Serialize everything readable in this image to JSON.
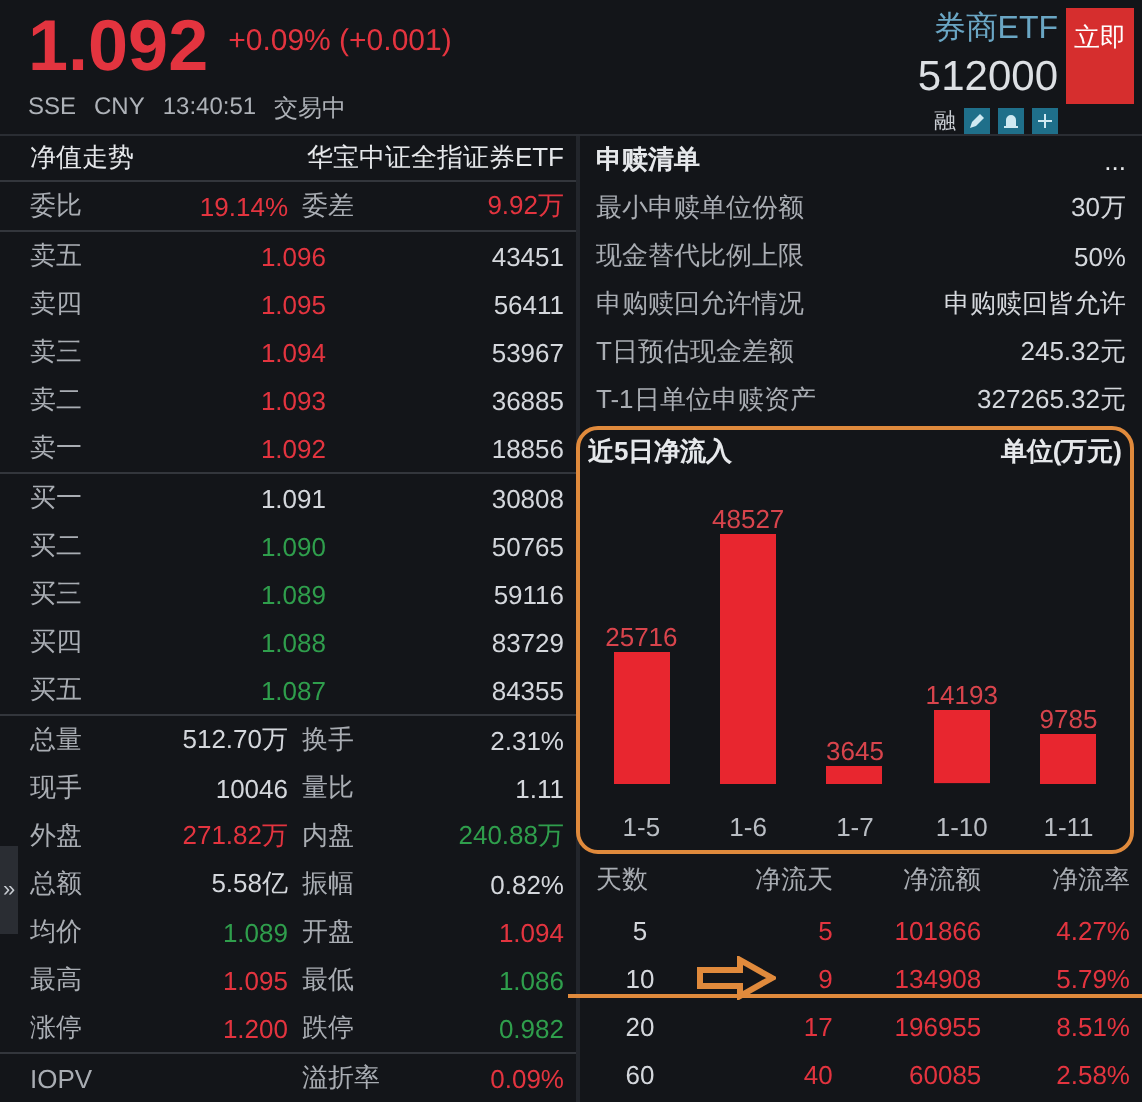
{
  "header": {
    "price": "1.092",
    "change": "+0.09% (+0.001)",
    "exchange": "SSE",
    "currency": "CNY",
    "time": "13:40:51",
    "status": "交易中",
    "fund_short": "券商ETF",
    "code": "512000",
    "action_button": "立即",
    "margin_tag": "融"
  },
  "left": {
    "title": "净值走势",
    "fund_name": "华宝中证全指证券ETF",
    "ratio": [
      {
        "label": "委比",
        "value": "19.14%",
        "color": "#e3343f"
      },
      {
        "label": "委差",
        "value": "9.92万",
        "color": "#e3343f"
      }
    ],
    "asks": [
      {
        "label": "卖五",
        "price": "1.096",
        "color": "#e3343f",
        "volume": "43451"
      },
      {
        "label": "卖四",
        "price": "1.095",
        "color": "#e3343f",
        "volume": "56411"
      },
      {
        "label": "卖三",
        "price": "1.094",
        "color": "#e3343f",
        "volume": "53967"
      },
      {
        "label": "卖二",
        "price": "1.093",
        "color": "#e3343f",
        "volume": "36885"
      },
      {
        "label": "卖一",
        "price": "1.092",
        "color": "#e3343f",
        "volume": "18856"
      }
    ],
    "bids": [
      {
        "label": "买一",
        "price": "1.091",
        "color": "#d4d7dc",
        "volume": "30808"
      },
      {
        "label": "买二",
        "price": "1.090",
        "color": "#2f9e4c",
        "volume": "50765"
      },
      {
        "label": "买三",
        "price": "1.089",
        "color": "#2f9e4c",
        "volume": "59116"
      },
      {
        "label": "买四",
        "price": "1.088",
        "color": "#2f9e4c",
        "volume": "83729"
      },
      {
        "label": "买五",
        "price": "1.087",
        "color": "#2f9e4c",
        "volume": "84355"
      }
    ],
    "stats": [
      {
        "label": "总量",
        "value": "512.70万",
        "color": "#d4d7dc"
      },
      {
        "label": "换手",
        "value": "2.31%",
        "color": "#d4d7dc"
      },
      {
        "label": "现手",
        "value": "10046",
        "color": "#d4d7dc"
      },
      {
        "label": "量比",
        "value": "1.11",
        "color": "#d4d7dc"
      },
      {
        "label": "外盘",
        "value": "271.82万",
        "color": "#e3343f"
      },
      {
        "label": "内盘",
        "value": "240.88万",
        "color": "#2f9e4c"
      },
      {
        "label": "总额",
        "value": "5.58亿",
        "color": "#d4d7dc"
      },
      {
        "label": "振幅",
        "value": "0.82%",
        "color": "#d4d7dc"
      },
      {
        "label": "均价",
        "value": "1.089",
        "color": "#2f9e4c"
      },
      {
        "label": "开盘",
        "value": "1.094",
        "color": "#e3343f"
      },
      {
        "label": "最高",
        "value": "1.095",
        "color": "#e3343f"
      },
      {
        "label": "最低",
        "value": "1.086",
        "color": "#2f9e4c"
      },
      {
        "label": "涨停",
        "value": "1.200",
        "color": "#e3343f"
      },
      {
        "label": "跌停",
        "value": "0.982",
        "color": "#2f9e4c"
      }
    ],
    "iopv": [
      {
        "label": "IOPV"
      },
      {
        "label": "溢折率",
        "value": "0.09%",
        "color": "#e3343f"
      }
    ],
    "side_toggle": "»"
  },
  "right": {
    "title": "申赎清单",
    "more": "...",
    "rows": [
      {
        "label": "最小申赎单位份额",
        "value": "30万"
      },
      {
        "label": "现金替代比例上限",
        "value": "50%"
      },
      {
        "label": "申购赎回允许情况",
        "value": "申购赎回皆允许"
      },
      {
        "label": "T日预估现金差额",
        "value": "245.32元"
      },
      {
        "label": "T-1日单位申赎资产",
        "value": "327265.32元"
      }
    ],
    "chart_data": {
      "type": "bar",
      "title": "近5日净流入",
      "ylabel": "单位(万元)",
      "categories": [
        "1-5",
        "1-6",
        "1-7",
        "1-10",
        "1-11"
      ],
      "series": [
        {
          "color": "#e8262f",
          "values": [
            25716,
            48527,
            3645,
            14193,
            9785
          ]
        }
      ],
      "data_labels": true
    },
    "flow_table": {
      "columns": [
        "天数",
        "净流天",
        "净流额",
        "净流率"
      ],
      "rows": [
        {
          "days": "5",
          "net_days": "5",
          "amount": "101866",
          "rate": "4.27%"
        },
        {
          "days": "10",
          "net_days": "9",
          "amount": "134908",
          "rate": "5.79%"
        },
        {
          "days": "20",
          "net_days": "17",
          "amount": "196955",
          "rate": "8.51%"
        },
        {
          "days": "60",
          "net_days": "40",
          "amount": "60085",
          "rate": "2.58%"
        }
      ]
    }
  }
}
